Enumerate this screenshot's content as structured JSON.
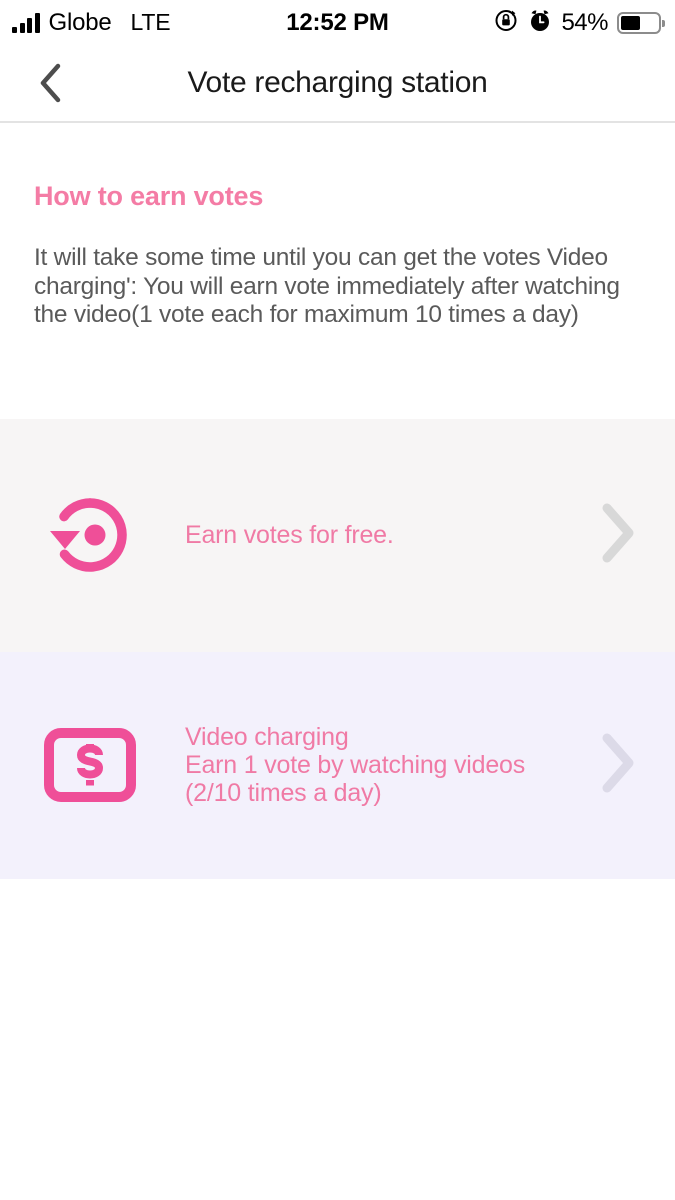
{
  "status_bar": {
    "carrier": "Globe",
    "network": "LTE",
    "time": "12:52 PM",
    "battery_percent": "54%",
    "battery_level": 54,
    "icons": [
      "signal-bars-icon",
      "rotation-lock-icon",
      "alarm-clock-icon",
      "battery-icon"
    ]
  },
  "navbar": {
    "back_icon": "chevron-left-icon",
    "title": "Vote recharging station"
  },
  "content": {
    "section_heading": "How to earn votes",
    "description": "It will take some time until you can get the votes Video charging': You will earn vote immediately after watching the video(1 vote each for maximum 10 times a day)"
  },
  "options": [
    {
      "icon": "rotate-refresh-icon",
      "title": "Earn votes for free.",
      "subtitle": "",
      "detail": "",
      "chevron": "chevron-right-icon",
      "background": "#f7f5f5"
    },
    {
      "icon": "money-bill-icon",
      "title": "Video charging",
      "subtitle": "Earn 1 vote by watching videos",
      "detail": "(2/10 times a day)",
      "chevron": "chevron-right-icon",
      "background": "#f3f1fc"
    }
  ],
  "colors": {
    "accent_pink": "#f07aa5",
    "icon_pink": "#ef4f98",
    "heading_pink": "#f47ca5",
    "body_gray": "#5a5a5a",
    "chevron_gray": "#d8d8d8"
  }
}
